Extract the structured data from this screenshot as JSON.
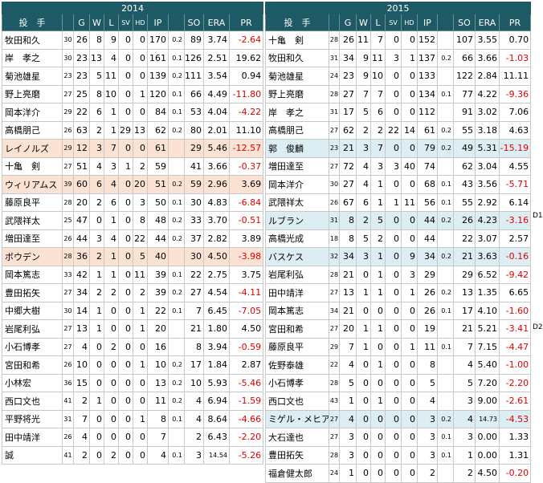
{
  "headers": [
    "投　手",
    "",
    "G",
    "W",
    "L",
    "SV",
    "HD",
    "IP",
    "",
    "SO",
    "ERA",
    "PR"
  ],
  "left": {
    "year": "2014",
    "rows": [
      {
        "name": "牧田和久",
        "age": "30",
        "g": "26",
        "w": "8",
        "l": "9",
        "sv": "0",
        "hd": "0",
        "ip": "170",
        "ipf": "0.2",
        "so": "89",
        "era": "3.74",
        "pr": "-2.64",
        "neg": true,
        "hl": ""
      },
      {
        "name": "岸　孝之",
        "age": "30",
        "g": "23",
        "w": "13",
        "l": "4",
        "sv": "0",
        "hd": "0",
        "ip": "161",
        "ipf": "0.1",
        "so": "126",
        "era": "2.51",
        "pr": "19.62",
        "neg": false,
        "hl": ""
      },
      {
        "name": "菊池雄星",
        "age": "23",
        "g": "23",
        "w": "5",
        "l": "11",
        "sv": "0",
        "hd": "0",
        "ip": "139",
        "ipf": "0.2",
        "so": "111",
        "era": "3.54",
        "pr": "0.94",
        "neg": false,
        "hl": ""
      },
      {
        "name": "野上亮磨",
        "age": "27",
        "g": "25",
        "w": "8",
        "l": "10",
        "sv": "0",
        "hd": "1",
        "ip": "120",
        "ipf": "0.1",
        "so": "66",
        "era": "4.49",
        "pr": "-11.80",
        "neg": true,
        "hl": ""
      },
      {
        "name": "岡本洋介",
        "age": "29",
        "g": "22",
        "w": "6",
        "l": "1",
        "sv": "0",
        "hd": "0",
        "ip": "84",
        "ipf": "0.1",
        "so": "53",
        "era": "4.04",
        "pr": "-4.22",
        "neg": true,
        "hl": ""
      },
      {
        "name": "高橋朋己",
        "age": "26",
        "g": "63",
        "w": "2",
        "l": "1",
        "sv": "29",
        "hd": "13",
        "ip": "62",
        "ipf": "0.2",
        "so": "80",
        "era": "2.01",
        "pr": "11.10",
        "neg": false,
        "hl": ""
      },
      {
        "name": "レイノルズ",
        "age": "29",
        "g": "12",
        "w": "3",
        "l": "7",
        "sv": "0",
        "hd": "0",
        "ip": "61",
        "ipf": "",
        "so": "29",
        "era": "5.46",
        "pr": "-12.57",
        "neg": true,
        "hl": "foreign"
      },
      {
        "name": "十亀　剣",
        "age": "27",
        "g": "51",
        "w": "4",
        "l": "3",
        "sv": "1",
        "hd": "2",
        "ip": "59",
        "ipf": "",
        "so": "41",
        "era": "3.66",
        "pr": "-0.37",
        "neg": true,
        "hl": ""
      },
      {
        "name": "ウィリアムス",
        "age": "39",
        "g": "60",
        "w": "6",
        "l": "4",
        "sv": "0",
        "hd": "20",
        "ip": "51",
        "ipf": "0.2",
        "so": "59",
        "era": "2.96",
        "pr": "3.69",
        "neg": false,
        "hl": "foreign"
      },
      {
        "name": "藤原良平",
        "age": "28",
        "g": "20",
        "w": "2",
        "l": "6",
        "sv": "0",
        "hd": "3",
        "ip": "50",
        "ipf": "0.1",
        "so": "30",
        "era": "4.83",
        "pr": "-6.84",
        "neg": true,
        "hl": ""
      },
      {
        "name": "武隈祥太",
        "age": "25",
        "g": "47",
        "w": "0",
        "l": "1",
        "sv": "0",
        "hd": "8",
        "ip": "48",
        "ipf": "0.2",
        "so": "33",
        "era": "3.70",
        "pr": "-0.51",
        "neg": true,
        "hl": ""
      },
      {
        "name": "増田達至",
        "age": "26",
        "g": "44",
        "w": "3",
        "l": "4",
        "sv": "0",
        "hd": "22",
        "ip": "44",
        "ipf": "0.2",
        "so": "37",
        "era": "2.82",
        "pr": "3.89",
        "neg": false,
        "hl": ""
      },
      {
        "name": "ボウデン",
        "age": "28",
        "g": "36",
        "w": "2",
        "l": "1",
        "sv": "0",
        "hd": "5",
        "ip": "40",
        "ipf": "",
        "so": "30",
        "era": "4.50",
        "pr": "-3.98",
        "neg": true,
        "hl": "foreign"
      },
      {
        "name": "岡本篤志",
        "age": "33",
        "g": "42",
        "w": "1",
        "l": "1",
        "sv": "0",
        "hd": "11",
        "ip": "39",
        "ipf": "0.1",
        "so": "22",
        "era": "2.75",
        "pr": "3.75",
        "neg": false,
        "hl": ""
      },
      {
        "name": "豊田拓矢",
        "age": "27",
        "g": "34",
        "w": "2",
        "l": "2",
        "sv": "0",
        "hd": "2",
        "ip": "39",
        "ipf": "0.2",
        "so": "27",
        "era": "4.54",
        "pr": "-4.11",
        "neg": true,
        "hl": ""
      },
      {
        "name": "中郷大樹",
        "age": "30",
        "g": "14",
        "w": "1",
        "l": "0",
        "sv": "0",
        "hd": "1",
        "ip": "22",
        "ipf": "0.1",
        "so": "7",
        "era": "6.45",
        "pr": "-7.05",
        "neg": true,
        "hl": ""
      },
      {
        "name": "岩尾利弘",
        "age": "27",
        "g": "13",
        "w": "1",
        "l": "0",
        "sv": "0",
        "hd": "1",
        "ip": "20",
        "ipf": "",
        "so": "21",
        "era": "1.80",
        "pr": "4.50",
        "neg": false,
        "hl": ""
      },
      {
        "name": "小石博孝",
        "age": "27",
        "g": "4",
        "w": "0",
        "l": "2",
        "sv": "0",
        "hd": "0",
        "ip": "16",
        "ipf": "",
        "so": "8",
        "era": "3.94",
        "pr": "-0.59",
        "neg": true,
        "hl": ""
      },
      {
        "name": "宮田和希",
        "age": "26",
        "g": "10",
        "w": "0",
        "l": "0",
        "sv": "0",
        "hd": "1",
        "ip": "10",
        "ipf": "0.2",
        "so": "17",
        "era": "1.84",
        "pr": "2.87",
        "neg": false,
        "hl": ""
      },
      {
        "name": "小林宏",
        "age": "36",
        "g": "15",
        "w": "0",
        "l": "0",
        "sv": "0",
        "hd": "0",
        "ip": "13",
        "ipf": "0.2",
        "so": "10",
        "era": "5.93",
        "pr": "-5.46",
        "neg": true,
        "hl": ""
      },
      {
        "name": "西口文也",
        "age": "41",
        "g": "2",
        "w": "1",
        "l": "0",
        "sv": "0",
        "hd": "0",
        "ip": "11",
        "ipf": "0.2",
        "so": "4",
        "era": "6.94",
        "pr": "-1.59",
        "neg": true,
        "hl": ""
      },
      {
        "name": "平野将光",
        "age": "31",
        "g": "7",
        "w": "0",
        "l": "0",
        "sv": "0",
        "hd": "1",
        "ip": "8",
        "ipf": "0.1",
        "so": "4",
        "era": "8.64",
        "pr": "-4.66",
        "neg": true,
        "hl": ""
      },
      {
        "name": "田中靖洋",
        "age": "26",
        "g": "4",
        "w": "0",
        "l": "0",
        "sv": "0",
        "hd": "0",
        "ip": "7",
        "ipf": "",
        "so": "2",
        "era": "6.43",
        "pr": "-2.20",
        "neg": true,
        "hl": ""
      },
      {
        "name": "誠",
        "age": "41",
        "g": "2",
        "w": "0",
        "l": "2",
        "sv": "0",
        "hd": "0",
        "ip": "4",
        "ipf": "0.1",
        "so": "3",
        "era": "14.54",
        "pr": "-5.26",
        "neg": true,
        "hl": ""
      }
    ]
  },
  "right": {
    "year": "2015",
    "rows": [
      {
        "name": "十亀　剣",
        "age": "28",
        "g": "26",
        "w": "11",
        "l": "7",
        "sv": "0",
        "hd": "0",
        "ip": "152",
        "ipf": "",
        "so": "107",
        "era": "3.55",
        "pr": "0.70",
        "neg": false,
        "hl": ""
      },
      {
        "name": "牧田和久",
        "age": "31",
        "g": "34",
        "w": "9",
        "l": "11",
        "sv": "3",
        "hd": "1",
        "ip": "137",
        "ipf": "0.2",
        "so": "66",
        "era": "3.66",
        "pr": "-1.03",
        "neg": true,
        "hl": ""
      },
      {
        "name": "菊池雄星",
        "age": "24",
        "g": "23",
        "w": "9",
        "l": "10",
        "sv": "0",
        "hd": "0",
        "ip": "133",
        "ipf": "",
        "so": "122",
        "era": "2.84",
        "pr": "11.11",
        "neg": false,
        "hl": ""
      },
      {
        "name": "野上亮磨",
        "age": "28",
        "g": "27",
        "w": "7",
        "l": "7",
        "sv": "0",
        "hd": "0",
        "ip": "134",
        "ipf": "0.1",
        "so": "77",
        "era": "4.22",
        "pr": "-9.36",
        "neg": true,
        "hl": ""
      },
      {
        "name": "岸　孝之",
        "age": "31",
        "g": "17",
        "w": "5",
        "l": "6",
        "sv": "0",
        "hd": "0",
        "ip": "112",
        "ipf": "",
        "so": "91",
        "era": "3.02",
        "pr": "7.06",
        "neg": false,
        "hl": ""
      },
      {
        "name": "高橋朋己",
        "age": "27",
        "g": "62",
        "w": "2",
        "l": "2",
        "sv": "22",
        "hd": "14",
        "ip": "61",
        "ipf": "0.2",
        "so": "55",
        "era": "3.18",
        "pr": "4.63",
        "neg": false,
        "hl": ""
      },
      {
        "name": "郭　俊麟",
        "age": "23",
        "g": "21",
        "w": "3",
        "l": "7",
        "sv": "0",
        "hd": "0",
        "ip": "79",
        "ipf": "0.2",
        "so": "49",
        "era": "5.31",
        "pr": "-15.19",
        "neg": true,
        "hl": "foreignb"
      },
      {
        "name": "増田達至",
        "age": "27",
        "g": "72",
        "w": "4",
        "l": "3",
        "sv": "3",
        "hd": "40",
        "ip": "74",
        "ipf": "",
        "so": "62",
        "era": "3.04",
        "pr": "4.55",
        "neg": false,
        "hl": ""
      },
      {
        "name": "岡本洋介",
        "age": "30",
        "g": "27",
        "w": "4",
        "l": "1",
        "sv": "0",
        "hd": "0",
        "ip": "68",
        "ipf": "0.1",
        "so": "43",
        "era": "3.56",
        "pr": "-5.71",
        "neg": true,
        "hl": ""
      },
      {
        "name": "武隈祥太",
        "age": "26",
        "g": "67",
        "w": "6",
        "l": "1",
        "sv": "1",
        "hd": "11",
        "ip": "56",
        "ipf": "0.1",
        "so": "55",
        "era": "2.92",
        "pr": "6.14",
        "neg": false,
        "hl": ""
      },
      {
        "name": "ルブラン",
        "age": "31",
        "g": "8",
        "w": "2",
        "l": "5",
        "sv": "0",
        "hd": "0",
        "ip": "44",
        "ipf": "0.2",
        "so": "26",
        "era": "4.23",
        "pr": "-3.16",
        "neg": true,
        "hl": "foreignb"
      },
      {
        "name": "高橋光成",
        "age": "18",
        "g": "8",
        "w": "5",
        "l": "2",
        "sv": "0",
        "hd": "0",
        "ip": "44",
        "ipf": "",
        "so": "22",
        "era": "3.07",
        "pr": "2.57",
        "neg": false,
        "hl": ""
      },
      {
        "name": "バスケス",
        "age": "32",
        "g": "34",
        "w": "3",
        "l": "1",
        "sv": "0",
        "hd": "9",
        "ip": "34",
        "ipf": "0.2",
        "so": "21",
        "era": "3.63",
        "pr": "-0.16",
        "neg": true,
        "hl": "foreignb"
      },
      {
        "name": "岩尾利弘",
        "age": "28",
        "g": "21",
        "w": "0",
        "l": "1",
        "sv": "0",
        "hd": "3",
        "ip": "29",
        "ipf": "",
        "so": "29",
        "era": "6.52",
        "pr": "-9.42",
        "neg": true,
        "hl": ""
      },
      {
        "name": "田中靖洋",
        "age": "27",
        "g": "13",
        "w": "1",
        "l": "1",
        "sv": "0",
        "hd": "1",
        "ip": "26",
        "ipf": "0.2",
        "so": "13",
        "era": "1.35",
        "pr": "6.65",
        "neg": false,
        "hl": ""
      },
      {
        "name": "岡本篤志",
        "age": "34",
        "g": "21",
        "w": "0",
        "l": "0",
        "sv": "0",
        "hd": "0",
        "ip": "26",
        "ipf": "0.1",
        "so": "17",
        "era": "4.10",
        "pr": "-1.60",
        "neg": true,
        "hl": ""
      },
      {
        "name": "宮田和希",
        "age": "27",
        "g": "20",
        "w": "1",
        "l": "1",
        "sv": "0",
        "hd": "0",
        "ip": "19",
        "ipf": "",
        "so": "21",
        "era": "5.21",
        "pr": "-3.41",
        "neg": true,
        "hl": ""
      },
      {
        "name": "藤原良平",
        "age": "29",
        "g": "7",
        "w": "1",
        "l": "0",
        "sv": "0",
        "hd": "1",
        "ip": "11",
        "ipf": "0.1",
        "so": "7",
        "era": "7.15",
        "pr": "-4.47",
        "neg": true,
        "hl": ""
      },
      {
        "name": "佐野泰雄",
        "age": "22",
        "g": "4",
        "w": "0",
        "l": "1",
        "sv": "0",
        "hd": "0",
        "ip": "8",
        "ipf": "",
        "so": "4",
        "era": "5.40",
        "pr": "-1.00",
        "neg": true,
        "hl": ""
      },
      {
        "name": "小石博孝",
        "age": "28",
        "g": "5",
        "w": "0",
        "l": "0",
        "sv": "0",
        "hd": "0",
        "ip": "5",
        "ipf": "",
        "so": "5",
        "era": "7.20",
        "pr": "-2.20",
        "neg": true,
        "hl": ""
      },
      {
        "name": "西口文也",
        "age": "43",
        "g": "1",
        "w": "0",
        "l": "1",
        "sv": "0",
        "hd": "0",
        "ip": "4",
        "ipf": "",
        "so": "3",
        "era": "9.00",
        "pr": "-2.61",
        "neg": true,
        "hl": ""
      },
      {
        "name": "ミゲル・メヒア",
        "age": "27",
        "g": "4",
        "w": "0",
        "l": "0",
        "sv": "0",
        "hd": "0",
        "ip": "3",
        "ipf": "0.2",
        "so": "4",
        "era": "14.73",
        "pr": "-4.53",
        "neg": true,
        "hl": "foreignb"
      },
      {
        "name": "大石達也",
        "age": "27",
        "g": "3",
        "w": "0",
        "l": "0",
        "sv": "0",
        "hd": "0",
        "ip": "3",
        "ipf": "0.1",
        "so": "3",
        "era": "0.00",
        "pr": "1.33",
        "neg": false,
        "hl": ""
      },
      {
        "name": "豊田拓矢",
        "age": "28",
        "g": "3",
        "w": "0",
        "l": "0",
        "sv": "0",
        "hd": "0",
        "ip": "3",
        "ipf": "0.1",
        "so": "1",
        "era": "0.00",
        "pr": "1.31",
        "neg": false,
        "hl": ""
      },
      {
        "name": "福倉健太郎",
        "age": "24",
        "g": "1",
        "w": "0",
        "l": "0",
        "sv": "0",
        "hd": "0",
        "ip": "2",
        "ipf": "",
        "so": "2",
        "era": "4.50",
        "pr": "-0.20",
        "neg": true,
        "hl": ""
      }
    ]
  },
  "notes": {
    "d1": "D1",
    "d2": "D2"
  }
}
